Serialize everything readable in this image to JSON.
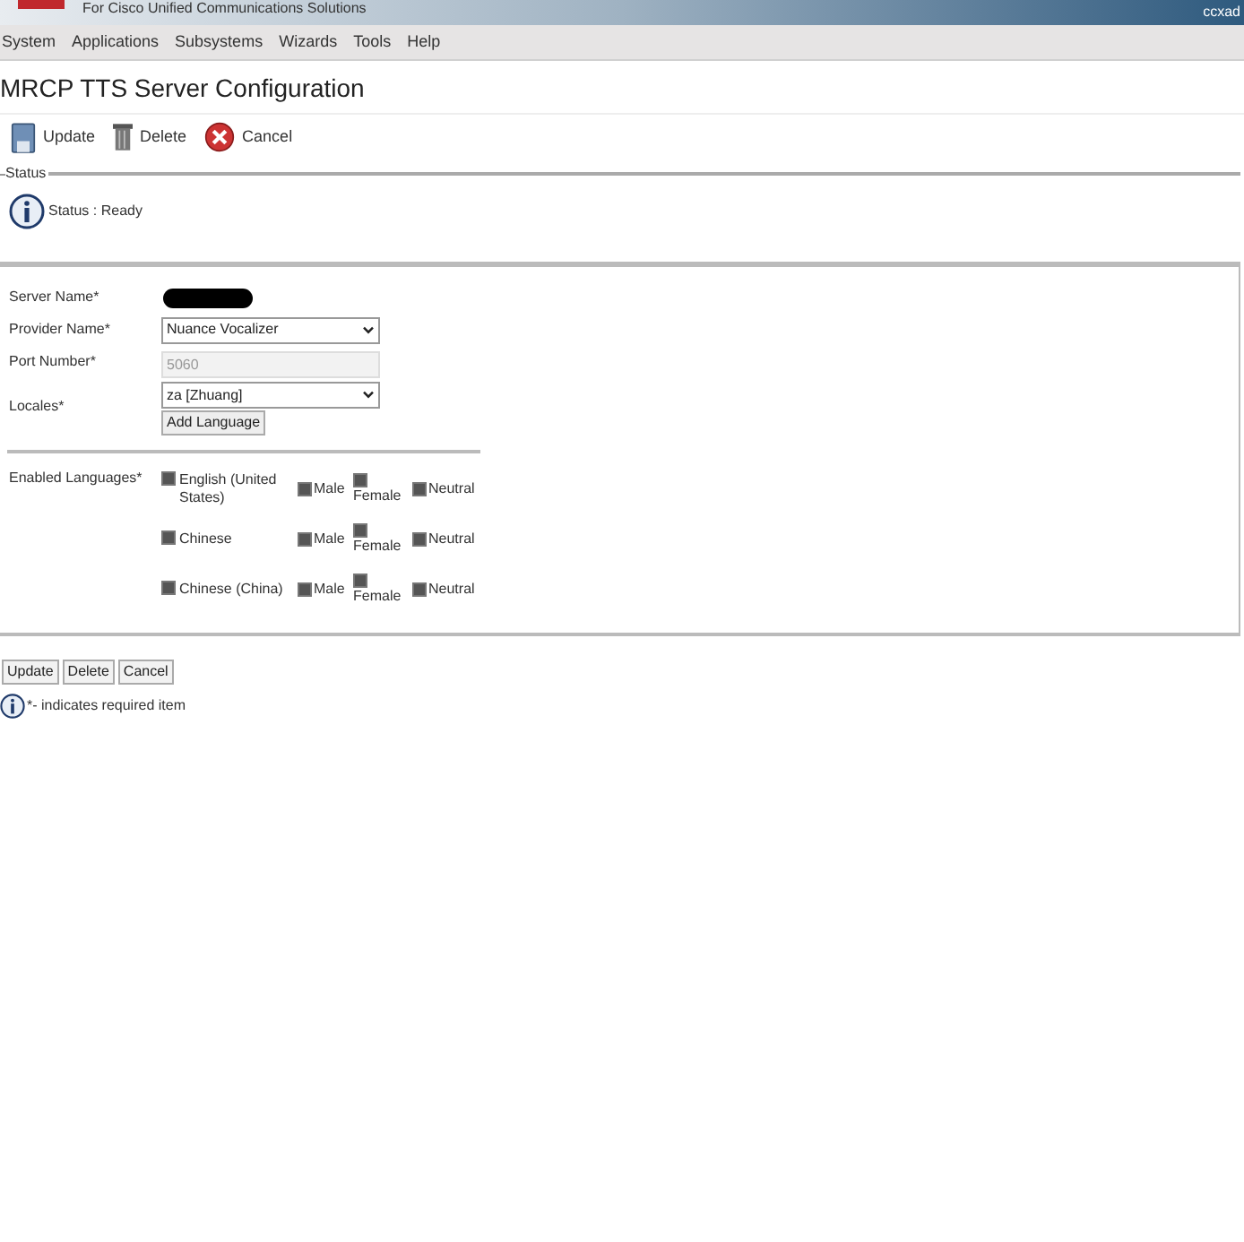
{
  "header": {
    "tagline": "For Cisco Unified Communications Solutions",
    "user": "ccxad"
  },
  "menu": [
    "System",
    "Applications",
    "Subsystems",
    "Wizards",
    "Tools",
    "Help"
  ],
  "title": "MRCP TTS Server Configuration",
  "toolbar": [
    {
      "kind": "save",
      "label": "Update"
    },
    {
      "kind": "trash",
      "label": "Delete"
    },
    {
      "kind": "cancel",
      "label": "Cancel"
    }
  ],
  "status": {
    "legend": "Status",
    "text": "Status : Ready"
  },
  "form": {
    "server_name": {
      "label": "Server Name*"
    },
    "provider": {
      "label": "Provider Name*",
      "value": "Nuance Vocalizer"
    },
    "port": {
      "label": "Port Number*",
      "value": "5060",
      "disabled": true
    },
    "locales": {
      "label": "Locales*",
      "value": "za [Zhuang]",
      "button": "Add Language"
    },
    "enabled_languages": {
      "label": "Enabled Languages*",
      "rows": [
        {
          "name": "English (United States)",
          "checked": true,
          "male": {
            "label": "Male",
            "checked": true
          },
          "female": {
            "label": "Female",
            "checked": true
          },
          "neutral": {
            "label": "Neutral",
            "checked": true
          }
        },
        {
          "name": "Chinese",
          "checked": true,
          "male": {
            "label": "Male",
            "checked": true
          },
          "female": {
            "label": "Female",
            "checked": true
          },
          "neutral": {
            "label": "Neutral",
            "checked": true
          }
        },
        {
          "name": "Chinese (China)",
          "checked": true,
          "male": {
            "label": "Male",
            "checked": true
          },
          "female": {
            "label": "Female",
            "checked": true
          },
          "neutral": {
            "label": "Neutral",
            "checked": true
          }
        }
      ]
    }
  },
  "bottom_buttons": [
    "Update",
    "Delete",
    "Cancel"
  ],
  "note": "*- indicates required item"
}
